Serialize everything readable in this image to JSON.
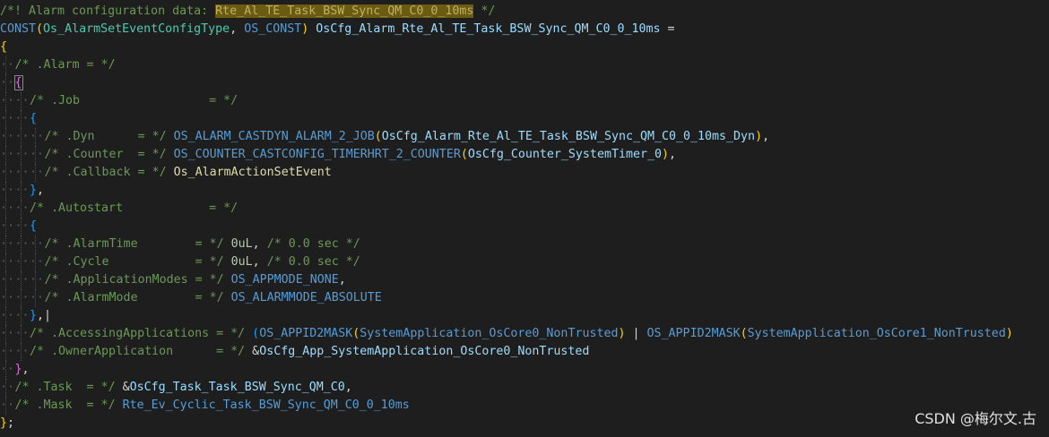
{
  "lines": [
    [
      {
        "t": "/*! Alarm configuration data: ",
        "c": "cm"
      },
      {
        "t": "Rte_Al_TE_Task_BSW_Sync_QM_C0_0_10ms",
        "c": "hl"
      },
      {
        "t": " */",
        "c": "cm"
      }
    ],
    [
      {
        "t": "CONST",
        "c": "mac"
      },
      {
        "t": "(",
        "c": "br1"
      },
      {
        "t": "Os_AlarmSetEventConfigType",
        "c": "ty"
      },
      {
        "t": ", ",
        "c": "op"
      },
      {
        "t": "OS_CONST",
        "c": "mac"
      },
      {
        "t": ")",
        "c": "br1"
      },
      {
        "t": " ",
        "c": "op"
      },
      {
        "t": "OsCfg_Alarm_Rte_Al_TE_Task_BSW_Sync_QM_C0_0_10ms",
        "c": "var"
      },
      {
        "t": " =",
        "c": "op"
      }
    ],
    [
      {
        "t": "{",
        "c": "br1"
      }
    ],
    [
      {
        "i": 1
      },
      {
        "t": "/* .Alarm = */",
        "c": "cm"
      }
    ],
    [
      {
        "i": 1
      },
      {
        "t": "{",
        "c": "br2 bmark"
      }
    ],
    [
      {
        "i": 2
      },
      {
        "t": "/* .Job                  = */",
        "c": "cm"
      }
    ],
    [
      {
        "i": 2
      },
      {
        "t": "{",
        "c": "br3"
      }
    ],
    [
      {
        "i": 3
      },
      {
        "t": "/* .Dyn      = */ ",
        "c": "cm"
      },
      {
        "t": "OS_ALARM_CASTDYN_ALARM_2_JOB",
        "c": "mac"
      },
      {
        "t": "(",
        "c": "br1"
      },
      {
        "t": "OsCfg_Alarm_Rte_Al_TE_Task_BSW_Sync_QM_C0_0_10ms_Dyn",
        "c": "var"
      },
      {
        "t": ")",
        "c": "br1"
      },
      {
        "t": ",",
        "c": "op"
      }
    ],
    [
      {
        "i": 3
      },
      {
        "t": "/* .Counter  = */ ",
        "c": "cm"
      },
      {
        "t": "OS_COUNTER_CASTCONFIG_TIMERHRT_2_COUNTER",
        "c": "mac"
      },
      {
        "t": "(",
        "c": "br1"
      },
      {
        "t": "OsCfg_Counter_SystemTimer_0",
        "c": "var"
      },
      {
        "t": ")",
        "c": "br1"
      },
      {
        "t": ",",
        "c": "op"
      }
    ],
    [
      {
        "i": 3
      },
      {
        "t": "/* .Callback = */ ",
        "c": "cm"
      },
      {
        "t": "Os_AlarmActionSetEvent",
        "c": "fn"
      }
    ],
    [
      {
        "i": 2
      },
      {
        "t": "}",
        "c": "br3"
      },
      {
        "t": ",",
        "c": "op"
      }
    ],
    [
      {
        "i": 2
      },
      {
        "t": "/* .Autostart            = */",
        "c": "cm"
      }
    ],
    [
      {
        "i": 2
      },
      {
        "t": "{",
        "c": "br3"
      }
    ],
    [
      {
        "i": 3
      },
      {
        "t": "/* .AlarmTime        = */ ",
        "c": "cm"
      },
      {
        "t": "0uL",
        "c": "num"
      },
      {
        "t": ", ",
        "c": "op"
      },
      {
        "t": "/* 0.0 sec */",
        "c": "cm"
      }
    ],
    [
      {
        "i": 3
      },
      {
        "t": "/* .Cycle            = */ ",
        "c": "cm"
      },
      {
        "t": "0uL",
        "c": "num"
      },
      {
        "t": ", ",
        "c": "op"
      },
      {
        "t": "/* 0.0 sec */",
        "c": "cm"
      }
    ],
    [
      {
        "i": 3
      },
      {
        "t": "/* .ApplicationModes = */ ",
        "c": "cm"
      },
      {
        "t": "OS_APPMODE_NONE",
        "c": "mac"
      },
      {
        "t": ",",
        "c": "op"
      }
    ],
    [
      {
        "i": 3
      },
      {
        "t": "/* .AlarmMode        = */ ",
        "c": "cm"
      },
      {
        "t": "OS_ALARMMODE_ABSOLUTE",
        "c": "mac"
      }
    ],
    [
      {
        "i": 2
      },
      {
        "t": "}",
        "c": "br3"
      },
      {
        "t": ",",
        "c": "op"
      },
      {
        "t": "|",
        "c": "op"
      }
    ],
    [
      {
        "i": 2
      },
      {
        "t": "/* .AccessingApplications = */ ",
        "c": "cm"
      },
      {
        "t": "(",
        "c": "br3"
      },
      {
        "t": "OS_APPID2MASK",
        "c": "mac"
      },
      {
        "t": "(",
        "c": "br1"
      },
      {
        "t": "SystemApplication_OsCore0_NonTrusted",
        "c": "mac"
      },
      {
        "t": ")",
        "c": "br1"
      },
      {
        "t": " | ",
        "c": "op"
      },
      {
        "t": "OS_APPID2MASK",
        "c": "mac"
      },
      {
        "t": "(",
        "c": "br1"
      },
      {
        "t": "SystemApplication_OsCore1_NonTrusted",
        "c": "mac"
      },
      {
        "t": ")",
        "c": "br1"
      }
    ],
    [
      {
        "i": 2
      },
      {
        "t": "/* .OwnerApplication      = */ ",
        "c": "cm"
      },
      {
        "t": "&",
        "c": "op"
      },
      {
        "t": "OsCfg_App_SystemApplication_OsCore0_NonTrusted",
        "c": "var"
      }
    ],
    [
      {
        "i": 1
      },
      {
        "t": "}",
        "c": "br2"
      },
      {
        "t": ",",
        "c": "op"
      }
    ],
    [
      {
        "i": 1
      },
      {
        "t": "/* .Task  = */ ",
        "c": "cm"
      },
      {
        "t": "&",
        "c": "op"
      },
      {
        "t": "OsCfg_Task_Task_BSW_Sync_QM_C0",
        "c": "var"
      },
      {
        "t": ",",
        "c": "op"
      }
    ],
    [
      {
        "i": 1
      },
      {
        "t": "/* .Mask  = */ ",
        "c": "cm"
      },
      {
        "t": "Rte_Ev_Cyclic_Task_BSW_Sync_QM_C0_0_10ms",
        "c": "mac"
      }
    ],
    [
      {
        "t": "}",
        "c": "br1"
      },
      {
        "t": ";",
        "c": "op"
      }
    ]
  ],
  "watermark": "CSDN @梅尔文.古"
}
